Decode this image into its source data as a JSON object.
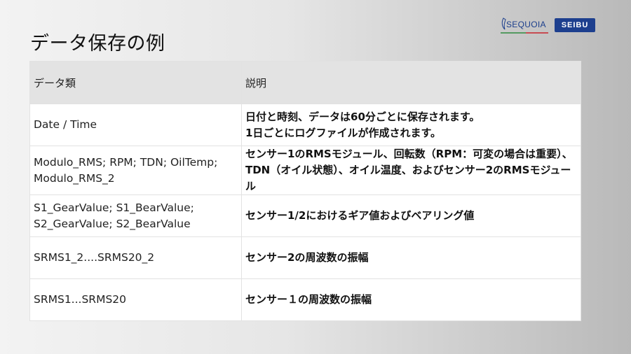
{
  "slide": {
    "title": "データ保存の例"
  },
  "logos": {
    "sequoia": "SEQUOIA",
    "seibu": "SEIBU"
  },
  "table": {
    "headers": [
      "データ類",
      "説明"
    ],
    "rows": [
      {
        "type": "Date / Time",
        "desc": "日付と時刻、データは60分ごとに保存されます。\n1日ごとにログファイルが作成されます。"
      },
      {
        "type": "Modulo_RMS; RPM; TDN; OilTemp;\nModulo_RMS_2",
        "desc": "センサー1のRMSモジュール、回転数（RPM：可変の場合は重要）、TDN（オイル状態）、オイル温度、およびセンサー2のRMSモジュール"
      },
      {
        "type": "S1_GearValue; S1_BearValue;\nS2_GearValue; S2_BearValue",
        "desc": "センサー1/2におけるギア値およびベアリング値"
      },
      {
        "type": "SRMS1_2....SRMS20_2",
        "desc": "センサー2の周波数の振幅"
      },
      {
        "type": "SRMS1...SRMS20",
        "desc": "センサー１の周波数の振幅"
      }
    ]
  }
}
